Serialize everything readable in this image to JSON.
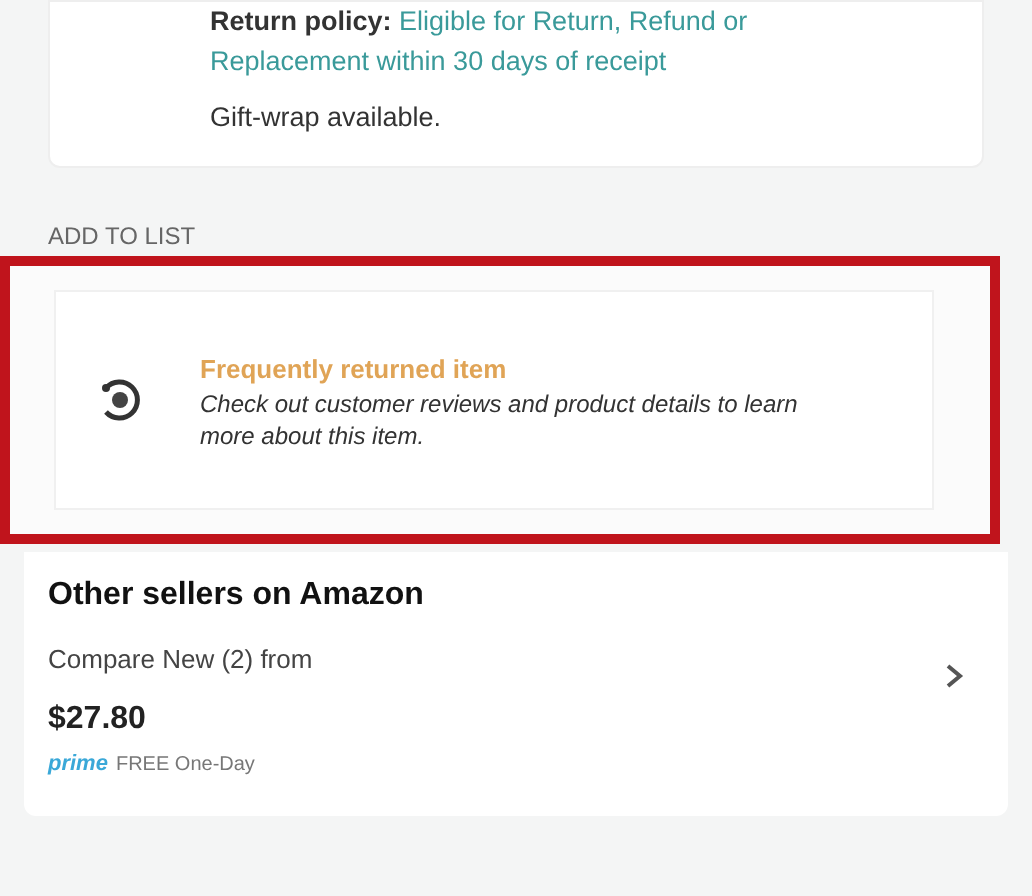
{
  "return_info": {
    "policy_label": "Return policy:",
    "policy_text": "Eligible for Return, Refund or Replacement within 30 days of receipt",
    "gift_wrap": "Gift-wrap available."
  },
  "add_to_list": "ADD TO LIST",
  "notice": {
    "title": "Frequently returned item",
    "body": "Check out customer reviews and product details to learn more about this item.",
    "highlighted": true
  },
  "other_sellers": {
    "title": "Other sellers on Amazon",
    "compare": "Compare New (2) from",
    "price": "$27.80",
    "prime": "prime",
    "delivery": "FREE One-Day"
  }
}
